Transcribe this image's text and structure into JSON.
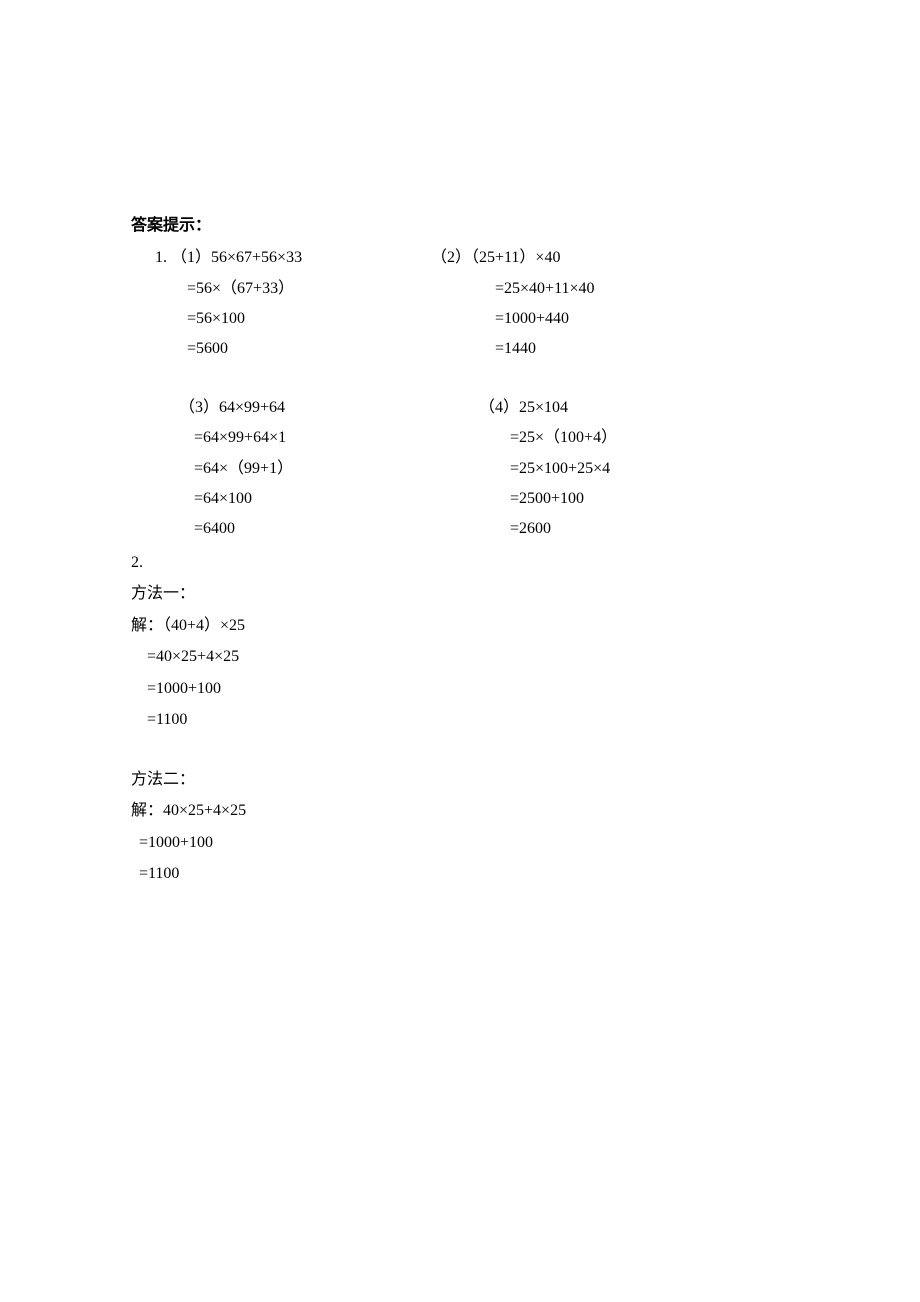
{
  "heading": "答案提示：",
  "q1": {
    "label": "1.",
    "p1": {
      "left": [
        "（1）56×67+56×33",
        "=56×（67+33）",
        "=56×100",
        "=5600"
      ],
      "right": [
        "（2）（25+11）×40",
        "=25×40+11×40",
        "=1000+440",
        "=1440"
      ]
    },
    "p2": {
      "left": [
        "（3）64×99+64",
        "=64×99+64×1",
        "=64×（99+1）",
        "=64×100",
        "=6400"
      ],
      "right": [
        "（4）25×104",
        "=25×（100+4）",
        "=25×100+25×4",
        "=2500+100",
        "=2600"
      ]
    }
  },
  "q2": {
    "label": "2.",
    "m1": {
      "title": "方法一：",
      "lines": [
        "解：（40+4）×25",
        "=40×25+4×25",
        "=1000+100",
        "=1100"
      ]
    },
    "m2": {
      "title": "方法二：",
      "lines": [
        "解：40×25+4×25",
        "=1000+100",
        "=1100"
      ]
    }
  }
}
